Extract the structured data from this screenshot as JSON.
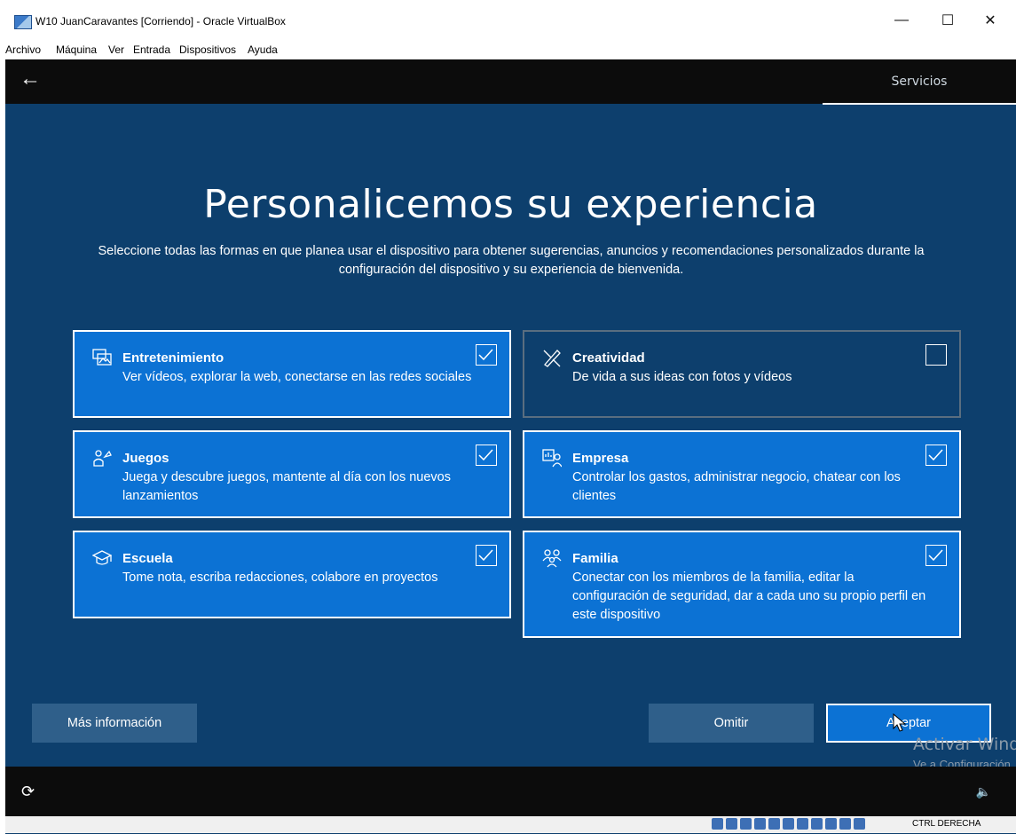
{
  "window": {
    "title": "W10 JuanCaravantes [Corriendo] - Oracle VirtualBox",
    "minimize_glyph": "—",
    "maximize_glyph": "☐",
    "close_glyph": "✕"
  },
  "menu": [
    "Archivo",
    "Máquina",
    "Ver",
    "Entrada",
    "Dispositivos",
    "Ayuda"
  ],
  "header": {
    "back_glyph": "←",
    "tab": "Servicios"
  },
  "page": {
    "title": "Personalicemos su experiencia",
    "subtitle": "Seleccione todas las formas en que planea usar el dispositivo para obtener sugerencias, anuncios y recomendaciones personalizados durante la configuración del dispositivo y su experiencia de bienvenida."
  },
  "cards": [
    {
      "title": "Entretenimiento",
      "desc": "Ver vídeos, explorar la web, conectarse en las redes sociales",
      "checked": true,
      "icon": "entertainment-icon"
    },
    {
      "title": "Creatividad",
      "desc": "De vida a sus ideas con fotos y vídeos",
      "checked": false,
      "icon": "creativity-icon"
    },
    {
      "title": "Juegos",
      "desc": "Juega y descubre juegos, mantente al día con los nuevos lanzamientos",
      "checked": true,
      "icon": "gaming-icon"
    },
    {
      "title": "Empresa",
      "desc": "Controlar los gastos, administrar negocio, chatear con los clientes",
      "checked": true,
      "icon": "business-icon"
    },
    {
      "title": "Escuela",
      "desc": "Tome nota, escriba redacciones, colabore en proyectos",
      "checked": true,
      "icon": "school-icon"
    },
    {
      "title": "Familia",
      "desc": "Conectar con los miembros de la familia, editar la configuración de seguridad, dar a cada uno su propio perfil en este dispositivo",
      "checked": true,
      "icon": "family-icon"
    }
  ],
  "buttons": {
    "more_info": "Más información",
    "skip": "Omitir",
    "accept": "Aceptar"
  },
  "watermark": {
    "line1": "Activar Windows",
    "line2": "Ve a Configuración"
  },
  "footer": {
    "accessibility_glyph": "⟳",
    "volume_glyph": "🔈"
  },
  "statusbar": {
    "host_key": "CTRL DERECHA"
  },
  "colors": {
    "card_selected": "#0c72d4",
    "background": "#0d3f6d",
    "button_secondary": "#2f5f8a"
  }
}
